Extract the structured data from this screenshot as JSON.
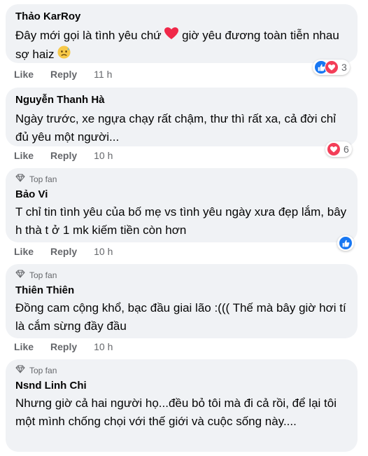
{
  "comments": [
    {
      "author": "Thảo KarRoy",
      "text_part1": "Đây mới gọi là tình yêu chứ",
      "text_part2": "giờ yêu đương toàn tiễn nhau sợ haiz",
      "actions": {
        "like": "Like",
        "reply": "Reply",
        "time": "11 h"
      },
      "reactions": {
        "count": "3",
        "types": [
          "like-icon",
          "love-icon"
        ]
      }
    },
    {
      "author": "Nguyễn Thanh Hà",
      "text": "Ngày trước, xe ngựa chạy rất chậm, thư thì rất xa, cả đời chỉ đủ yêu một người...",
      "actions": {
        "like": "Like",
        "reply": "Reply",
        "time": "10 h"
      },
      "reactions": {
        "count": "6",
        "types": [
          "love-icon"
        ]
      }
    },
    {
      "badge": "Top fan",
      "author": "Bảo Vi",
      "text": "T chỉ tin tình yêu của bố mẹ vs tình yêu ngày xưa đẹp lắm, bây h thà t ở 1 mk kiếm tiền còn hơn",
      "actions": {
        "like": "Like",
        "reply": "Reply",
        "time": "10 h"
      },
      "reactions": {
        "count": "",
        "types": [
          "like-icon"
        ]
      }
    },
    {
      "badge": "Top fan",
      "author": "Thiên Thiên",
      "text": "Đồng cam cộng khổ, bạc đầu giai lão :((( Thế mà bây giờ hơi tí là cắm sừng đầy đầu",
      "actions": {
        "like": "Like",
        "reply": "Reply",
        "time": "10 h"
      }
    },
    {
      "badge": "Top fan",
      "author": "Nsnd Linh Chi",
      "text": "Nhưng giờ cả hai người họ...đều bỏ tôi mà đi cả rồi, để lại tôi một mình chống chọi với thế giới và cuộc sống này...."
    }
  ],
  "colors": {
    "bubble": "#f0f2f5",
    "like_blue": "#1877f2",
    "love_red": "#f33e58",
    "meta_gray": "#65676b"
  }
}
